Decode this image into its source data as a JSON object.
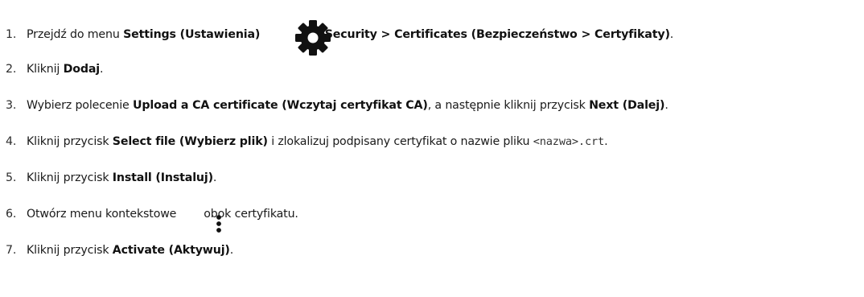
{
  "icons": {
    "settings": "gear-icon",
    "context_menu": "more-vertical-icon"
  },
  "steps": [
    {
      "num": "1.",
      "pre": "Przejdź do menu ",
      "bold1": "Settings (Ustawienia)",
      "sep": " > ",
      "bold2": "Security > Certificates (Bezpieczeństwo > Certyfikaty)",
      "end": "."
    },
    {
      "num": "2.",
      "pre": "Kliknij ",
      "bold1": "Dodaj",
      "end": "."
    },
    {
      "num": "3.",
      "pre": "Wybierz polecenie ",
      "bold1": "Upload a CA certificate (Wczytaj certyfikat CA)",
      "mid": ", a następnie kliknij przycisk ",
      "bold2": "Next (Dalej)",
      "end": "."
    },
    {
      "num": "4.",
      "pre": "Kliknij przycisk ",
      "bold1": "Select file (Wybierz plik)",
      "mid": " i zlokalizuj podpisany certyfikat o nazwie pliku ",
      "code": "<nazwa>.crt",
      "end": "."
    },
    {
      "num": "5.",
      "pre": "Kliknij przycisk ",
      "bold1": "Install (Instaluj)",
      "end": "."
    },
    {
      "num": "6.",
      "pre": "Otwórz menu kontekstowe",
      "post": "obok certyfikatu."
    },
    {
      "num": "7.",
      "pre": "Kliknij przycisk ",
      "bold1": "Activate (Aktywuj)",
      "end": "."
    }
  ]
}
